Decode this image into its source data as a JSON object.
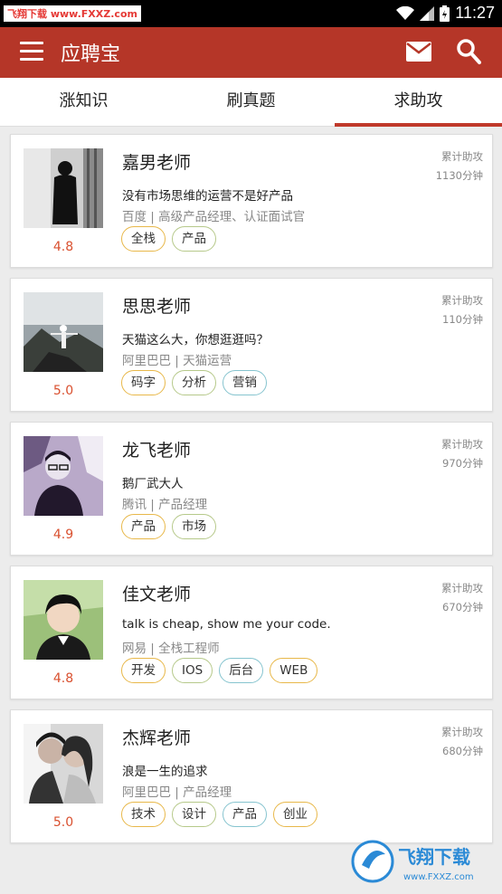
{
  "status_bar": {
    "watermark": "飞翔下载 www.FXXZ.com",
    "time": "11:27"
  },
  "app_bar": {
    "title": "应聘宝",
    "icons": [
      "menu-icon",
      "mail-icon",
      "search-icon"
    ]
  },
  "tabs": [
    {
      "label": "涨知识",
      "active": false
    },
    {
      "label": "刷真题",
      "active": false
    },
    {
      "label": "求助攻",
      "active": true
    }
  ],
  "teachers": [
    {
      "name": "嘉男老师",
      "motto": "没有市场思维的运营不是好产品",
      "company": "百度 | 高级产品经理、认证面试官",
      "rating": "4.8",
      "help_label": "累计助攻",
      "help_value": "1130分钟",
      "tags": [
        "全栈",
        "产品"
      ]
    },
    {
      "name": "思思老师",
      "motto": "天猫这么大，你想逛逛吗？",
      "company": "阿里巴巴 | 天猫运营",
      "rating": "5.0",
      "help_label": "累计助攻",
      "help_value": "110分钟",
      "tags": [
        "码字",
        "分析",
        "营销"
      ]
    },
    {
      "name": "龙飞老师",
      "motto": "鹅厂武大人",
      "company": "腾讯 | 产品经理",
      "rating": "4.9",
      "help_label": "累计助攻",
      "help_value": "970分钟",
      "tags": [
        "产品",
        "市场"
      ]
    },
    {
      "name": "佳文老师",
      "motto": "talk is cheap, show me your code.",
      "company": "网易 | 全栈工程师",
      "rating": "4.8",
      "help_label": "累计助攻",
      "help_value": "670分钟",
      "tags": [
        "开发",
        "IOS",
        "后台",
        "WEB"
      ]
    },
    {
      "name": "杰辉老师",
      "motto": "浪是一生的追求",
      "company": "阿里巴巴 | 产品经理",
      "rating": "5.0",
      "help_label": "累计助攻",
      "help_value": "680分钟",
      "tags": [
        "技术",
        "设计",
        "产品",
        "创业"
      ]
    }
  ],
  "watermark_logo": {
    "text": "飞翔下载",
    "url_text": "www.FXXZ.com"
  },
  "colors": {
    "app_bar": "#b53628",
    "accent": "#c0392b",
    "rating": "#d9502f"
  }
}
